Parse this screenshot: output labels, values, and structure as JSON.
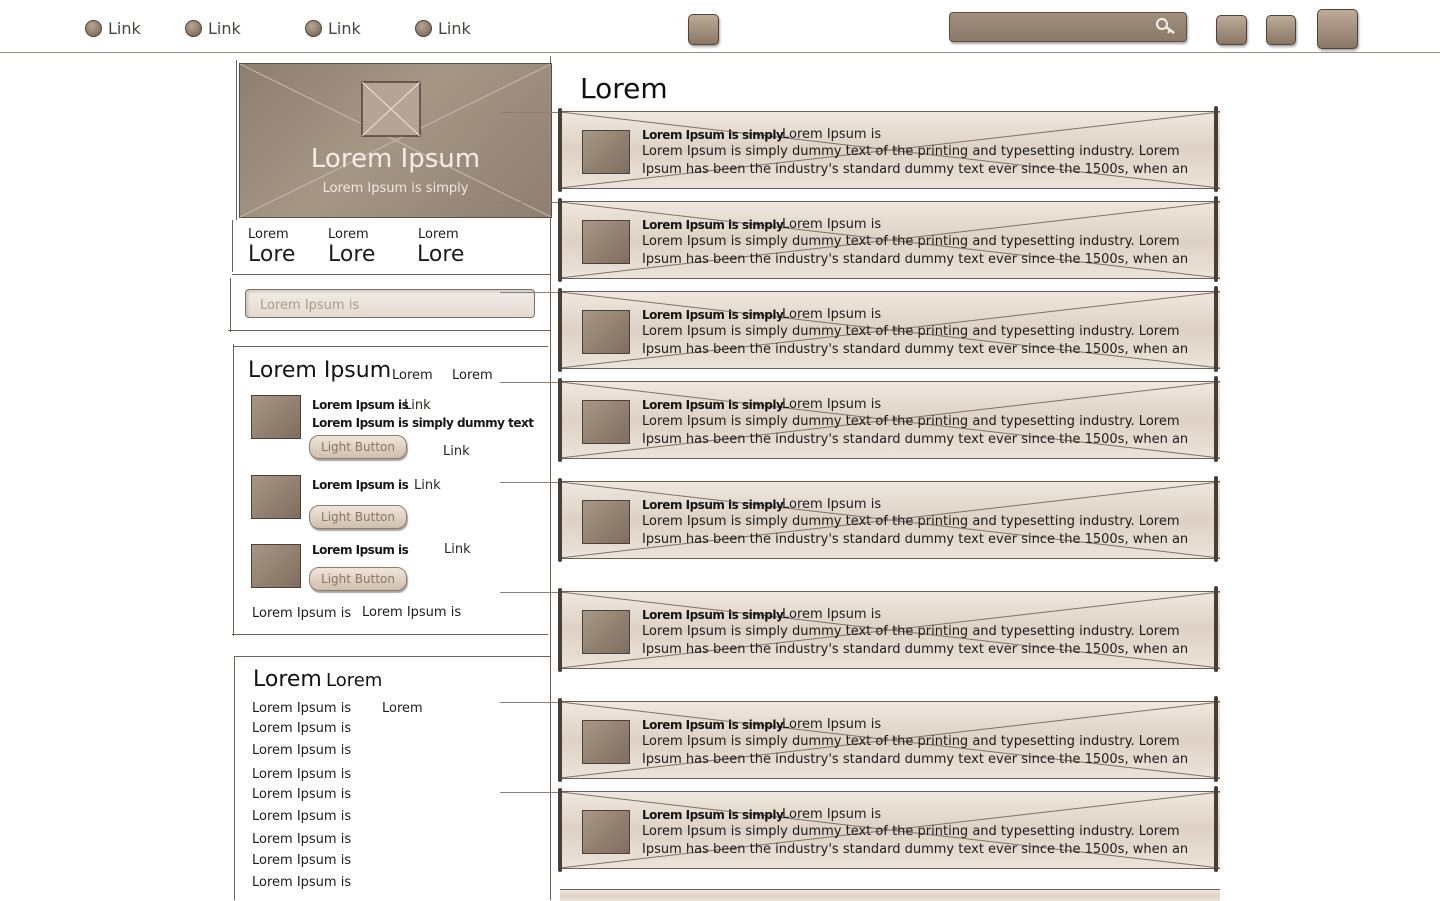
{
  "nav": {
    "links": [
      "Link",
      "Link",
      "Link",
      "Link"
    ]
  },
  "header": {
    "search_placeholder": ""
  },
  "hero": {
    "title": "Lorem Ipsum",
    "subtitle": "Lorem Ipsum is simply"
  },
  "stats": [
    {
      "label": "Lorem",
      "value": "Lore"
    },
    {
      "label": "Lorem",
      "value": "Lore"
    },
    {
      "label": "Lorem",
      "value": "Lore"
    }
  ],
  "sidebar_search": {
    "placeholder": "Lorem Ipsum is"
  },
  "section1": {
    "title": "Lorem Ipsum",
    "tab_a": "Lorem",
    "tab_b": "Lorem",
    "items": [
      {
        "title": "Lorem Ipsum is",
        "link": "Link",
        "desc": "Lorem Ipsum is simply dummy text",
        "button": "Light Button",
        "link2": "Link"
      },
      {
        "title": "Lorem Ipsum is",
        "link": "Link",
        "button": "Light Button"
      },
      {
        "title": "Lorem Ipsum is",
        "link": "Link",
        "button": "Light Button"
      }
    ],
    "footer_a": "Lorem Ipsum is",
    "footer_b": "Lorem Ipsum is"
  },
  "section2": {
    "title": "Lorem",
    "title_suffix": "Lorem",
    "extra": "Lorem",
    "items": [
      "Lorem Ipsum is",
      "Lorem Ipsum is",
      "Lorem Ipsum is",
      "Lorem Ipsum is",
      "Lorem Ipsum is",
      "Lorem Ipsum is",
      "Lorem Ipsum is",
      "Lorem Ipsum is",
      "Lorem Ipsum is"
    ]
  },
  "main": {
    "title": "Lorem",
    "cards": [
      {
        "heading": "Lorem Ipsum is simply",
        "subheading": "Lorem Ipsum is",
        "line1": "Lorem Ipsum is simply dummy text of the printing and typesetting industry. Lorem",
        "line2": "Ipsum has been the industry's standard dummy text ever since the 1500s, when an"
      },
      {
        "heading": "Lorem Ipsum is simply",
        "subheading": "Lorem Ipsum is",
        "line1": "Lorem Ipsum is simply dummy text of the printing and typesetting industry. Lorem",
        "line2": "Ipsum has been the industry's standard dummy text ever since the 1500s, when an"
      },
      {
        "heading": "Lorem Ipsum is simply",
        "subheading": "Lorem Ipsum is",
        "line1": "Lorem Ipsum is simply dummy text of the printing and typesetting industry. Lorem",
        "line2": "Ipsum has been the industry's standard dummy text ever since the 1500s, when an"
      },
      {
        "heading": "Lorem Ipsum is simply",
        "subheading": "Lorem Ipsum is",
        "line1": "Lorem Ipsum is simply dummy text of the printing and typesetting industry. Lorem",
        "line2": "Ipsum has been the industry's standard dummy text ever since the 1500s, when an"
      },
      {
        "heading": "Lorem Ipsum is simply",
        "subheading": "Lorem Ipsum is",
        "line1": "Lorem Ipsum is simply dummy text of the printing and typesetting industry. Lorem",
        "line2": "Ipsum has been the industry's standard dummy text ever since the 1500s, when an"
      },
      {
        "heading": "Lorem Ipsum is simply",
        "subheading": "Lorem Ipsum is",
        "line1": "Lorem Ipsum is simply dummy text of the printing and typesetting industry. Lorem",
        "line2": "Ipsum has been the industry's standard dummy text ever since the 1500s, when an"
      },
      {
        "heading": "Lorem Ipsum is simply",
        "subheading": "Lorem Ipsum is",
        "line1": "Lorem Ipsum is simply dummy text of the printing and typesetting industry. Lorem",
        "line2": "Ipsum has been the industry's standard dummy text ever since the 1500s, when an"
      },
      {
        "heading": "Lorem Ipsum is simply",
        "subheading": "Lorem Ipsum is",
        "line1": "Lorem Ipsum is simply dummy text of the printing and typesetting industry. Lorem",
        "line2": "Ipsum has been the industry's standard dummy text ever since the 1500s, when an"
      }
    ]
  },
  "colors": {
    "accent": "#8d7b69",
    "card_bg": "#e6ddd2",
    "border": "#6b5f55"
  },
  "icons": {
    "nav_bullet": "circle-bullet-icon",
    "search": "key-search-icon",
    "image_placeholder": "image-placeholder-icon"
  }
}
